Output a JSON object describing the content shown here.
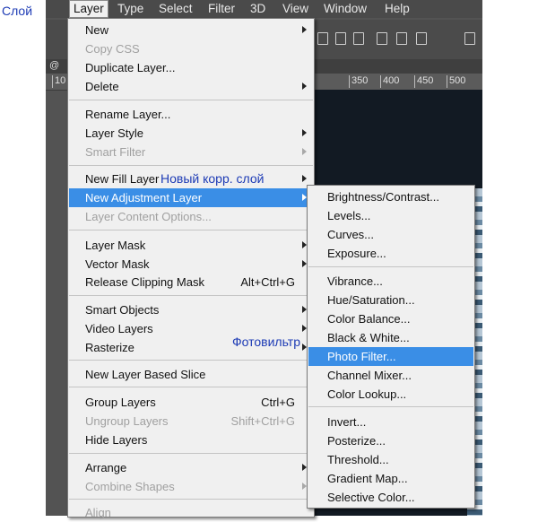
{
  "annotations": {
    "layer_ru": "Слой",
    "new_adjustment_ru": "Новый корр. слой",
    "photo_filter_ru": "Фотовильтр"
  },
  "menubar": {
    "items": [
      {
        "label": "Layer",
        "active": true
      },
      {
        "label": "Type"
      },
      {
        "label": "Select"
      },
      {
        "label": "Filter"
      },
      {
        "label": "3D"
      },
      {
        "label": "View"
      },
      {
        "label": "Window"
      },
      {
        "label": "Help"
      }
    ]
  },
  "document_tab": "@",
  "ruler": {
    "ticks": [
      "10",
      "350",
      "400",
      "450",
      "500"
    ]
  },
  "layer_menu": {
    "items": [
      {
        "label": "New",
        "submenu": true
      },
      {
        "label": "Copy CSS",
        "disabled": true
      },
      {
        "label": "Duplicate Layer..."
      },
      {
        "label": "Delete",
        "submenu": true
      },
      {
        "label": "Rename Layer..."
      },
      {
        "label": "Layer Style",
        "submenu": true
      },
      {
        "label": "Smart Filter",
        "disabled": true,
        "submenu": true
      },
      {
        "label": "New Fill Layer",
        "submenu": true
      },
      {
        "label": "New Adjustment Layer",
        "submenu": true,
        "highlighted": true
      },
      {
        "label": "Layer Content Options...",
        "disabled": true
      },
      {
        "label": "Layer Mask",
        "submenu": true
      },
      {
        "label": "Vector Mask",
        "submenu": true
      },
      {
        "label": "Release Clipping Mask",
        "shortcut": "Alt+Ctrl+G"
      },
      {
        "label": "Smart Objects",
        "submenu": true
      },
      {
        "label": "Video Layers",
        "submenu": true
      },
      {
        "label": "Rasterize",
        "submenu": true
      },
      {
        "label": "New Layer Based Slice"
      },
      {
        "label": "Group Layers",
        "shortcut": "Ctrl+G"
      },
      {
        "label": "Ungroup Layers",
        "shortcut": "Shift+Ctrl+G",
        "disabled": true
      },
      {
        "label": "Hide Layers"
      },
      {
        "label": "Arrange",
        "submenu": true
      },
      {
        "label": "Combine Shapes",
        "disabled": true,
        "submenu": true
      },
      {
        "label": "Align",
        "disabled": true
      }
    ]
  },
  "adjustment_menu": {
    "items": [
      {
        "label": "Brightness/Contrast..."
      },
      {
        "label": "Levels..."
      },
      {
        "label": "Curves..."
      },
      {
        "label": "Exposure..."
      },
      {
        "label": "Vibrance..."
      },
      {
        "label": "Hue/Saturation..."
      },
      {
        "label": "Color Balance..."
      },
      {
        "label": "Black & White..."
      },
      {
        "label": "Photo Filter...",
        "highlighted": true
      },
      {
        "label": "Channel Mixer..."
      },
      {
        "label": "Color Lookup..."
      },
      {
        "label": "Invert..."
      },
      {
        "label": "Posterize..."
      },
      {
        "label": "Threshold..."
      },
      {
        "label": "Gradient Map..."
      },
      {
        "label": "Selective Color..."
      }
    ]
  },
  "colors": {
    "highlight": "#3a8ee6",
    "annotation_text": "#1d3bb5",
    "menu_background": "#f0f0f0",
    "app_background": "#535353"
  }
}
